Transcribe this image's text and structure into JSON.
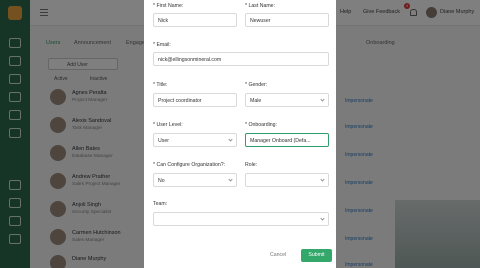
{
  "topbar": {
    "link_right1": "Help",
    "link_right2": "Give Feedback",
    "notif_count": "4",
    "user_name": "Diane Murphy"
  },
  "tabs": [
    "Users",
    "Announcement",
    "Engage",
    "Onboarding"
  ],
  "add_user_placeholder": "Add User",
  "filters": {
    "active": "Active",
    "inactive": "Inactive"
  },
  "rows": [
    {
      "name": "Agnes Peralta",
      "role": "Project Manager"
    },
    {
      "name": "Alexis Sandoval",
      "role": "Task Manager"
    },
    {
      "name": "Allen Bates",
      "role": "Database Manager"
    },
    {
      "name": "Andrew Prather",
      "role": "Sales Project Manager"
    },
    {
      "name": "Anjoli Singh",
      "role": "Security Specialist"
    },
    {
      "name": "Carmen Hutchinson",
      "role": "Sales Manager"
    },
    {
      "name": "Diane Murphy",
      "role": ""
    }
  ],
  "row_link": "Impersonate",
  "form": {
    "first_name_label": "* First Name:",
    "first_name_value": "Nick",
    "last_name_label": "* Last Name:",
    "last_name_value": "Newuser",
    "email_label": "* Email:",
    "email_value": "nick@ellingsonmineral.com",
    "title_label": "* Title:",
    "title_value": "Project coordinator",
    "gender_label": "* Gender:",
    "gender_value": "Male",
    "user_level_label": "* User Level:",
    "user_level_value": "User",
    "onboarding_label": "* Onboarding:",
    "onboarding_value": "Manager Onboard (Defa...",
    "can_configure_label": "* Can Configure Organization?:",
    "can_configure_value": "No",
    "role_label": "Role:",
    "role_value": "",
    "team_label": "Team:",
    "team_value": "",
    "cancel_label": "Cancel",
    "submit_label": "Submit"
  },
  "colors": {
    "sidebar": "#2f6b4f",
    "accent": "#34a86b",
    "focus_border": "#2f9e6a"
  }
}
